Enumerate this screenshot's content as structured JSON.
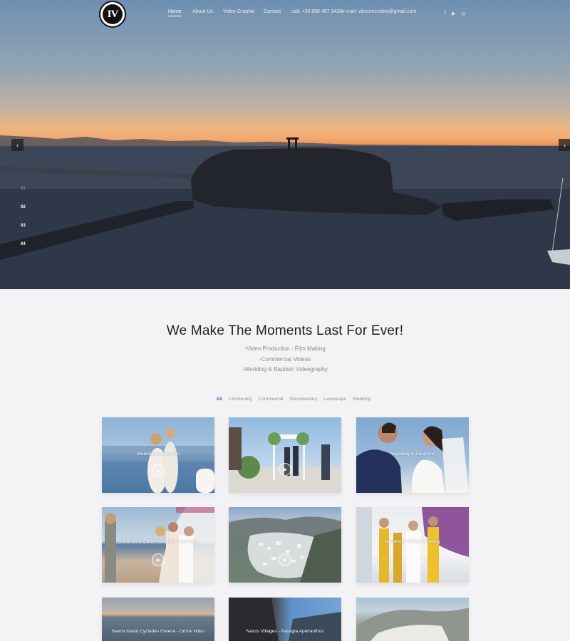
{
  "logo": {
    "text": "IV"
  },
  "nav": {
    "items": [
      {
        "label": "Home",
        "active": true
      },
      {
        "label": "About Us",
        "active": false
      },
      {
        "label": "Video Graphie",
        "active": false
      },
      {
        "label": "Contact",
        "active": false
      },
      {
        "label": "call: +30 698 457 3438",
        "active": false
      },
      {
        "label": "e-mail: vizcuresvideo@gmail.com",
        "active": false
      }
    ]
  },
  "social": [
    "facebook-icon",
    "youtube-icon",
    "instagram-icon"
  ],
  "social_glyphs": {
    "facebook": "f",
    "youtube": "▶",
    "instagram": "◎"
  },
  "slider": {
    "prev_glyph": "‹",
    "next_glyph": "›",
    "bullets": [
      "01",
      "02",
      "03",
      "04"
    ],
    "active_bullet": 0
  },
  "intro": {
    "headline": "We Make The Moments Last For Ever!",
    "services": [
      "-Video Production - Film Making",
      "-Commercial Videos",
      "-Wedding & Baptism Videography"
    ]
  },
  "filters": {
    "items": [
      "All",
      "Christening",
      "Commercial",
      "Documentary",
      "Landscape",
      "Wedding"
    ],
    "active": "All"
  },
  "portfolio": [
    {
      "caption": "Wedding in Santorini"
    },
    {
      "caption": ""
    },
    {
      "caption": "Wedding in Santorini"
    },
    {
      "caption": "Davaines & Carlo Wedding in Santorini"
    },
    {
      "caption": ""
    },
    {
      "caption": "Neneno & Tamas Wedding"
    },
    {
      "caption": "Naxos Island Cyclades Greece - Drone video"
    },
    {
      "caption": "Naxos Villages - Panagia Apeiranthos"
    },
    {
      "caption": ""
    }
  ]
}
